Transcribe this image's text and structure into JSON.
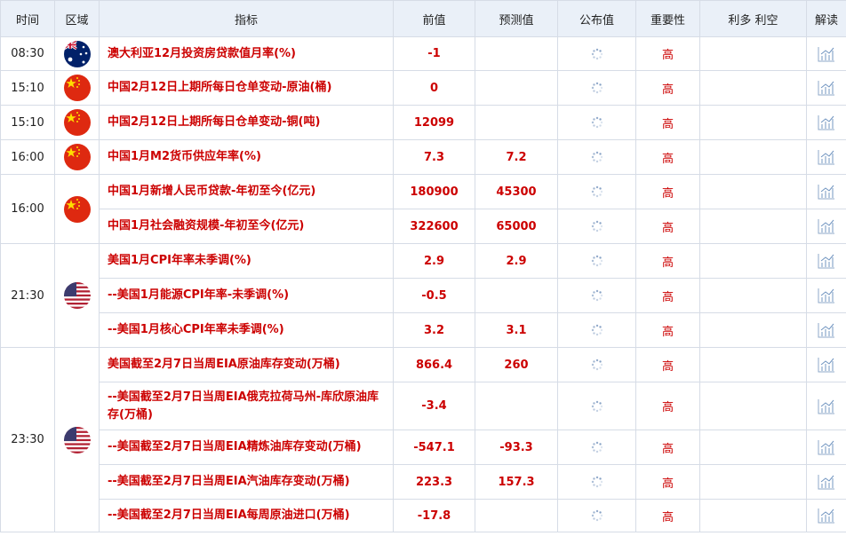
{
  "headers": {
    "time": "时间",
    "region": "区域",
    "indicator": "指标",
    "previous": "前值",
    "forecast": "预测值",
    "actual": "公布值",
    "importance": "重要性",
    "impact": "利多 利空",
    "analysis": "解读"
  },
  "colors": {
    "header_bg": "#eaf0f8",
    "accent_red": "#cc0000",
    "border": "#d6dce6"
  },
  "groups": [
    {
      "time": "08:30",
      "flag": "australia-flag-icon",
      "rows": [
        {
          "indicator": "澳大利亚12月投资房贷款值月率(%)",
          "previous": "-1",
          "forecast": "",
          "importance": "高"
        }
      ]
    },
    {
      "time": "15:10",
      "flag": "china-flag-icon",
      "rows": [
        {
          "indicator": "中国2月12日上期所每日仓单变动-原油(桶)",
          "previous": "0",
          "forecast": "",
          "importance": "高"
        }
      ]
    },
    {
      "time": "15:10",
      "flag": "china-flag-icon",
      "rows": [
        {
          "indicator": "中国2月12日上期所每日仓单变动-铜(吨)",
          "previous": "12099",
          "forecast": "",
          "importance": "高"
        }
      ]
    },
    {
      "time": "16:00",
      "flag": "china-flag-icon",
      "rows": [
        {
          "indicator": "中国1月M2货币供应年率(%)",
          "previous": "7.3",
          "forecast": "7.2",
          "importance": "高"
        }
      ]
    },
    {
      "time": "16:00",
      "flag": "china-flag-icon",
      "rows": [
        {
          "indicator": "中国1月新增人民币贷款-年初至今(亿元)",
          "previous": "180900",
          "forecast": "45300",
          "importance": "高"
        },
        {
          "indicator": "中国1月社会融资规模-年初至今(亿元)",
          "previous": "322600",
          "forecast": "65000",
          "importance": "高"
        }
      ]
    },
    {
      "time": "21:30",
      "flag": "usa-flag-icon",
      "rows": [
        {
          "indicator": "美国1月CPI年率未季调(%)",
          "previous": "2.9",
          "forecast": "2.9",
          "importance": "高"
        },
        {
          "indicator": "--美国1月能源CPI年率-未季调(%)",
          "previous": "-0.5",
          "forecast": "",
          "importance": "高"
        },
        {
          "indicator": "--美国1月核心CPI年率未季调(%)",
          "previous": "3.2",
          "forecast": "3.1",
          "importance": "高"
        }
      ]
    },
    {
      "time": "23:30",
      "flag": "usa-flag-icon",
      "rows": [
        {
          "indicator": "美国截至2月7日当周EIA原油库存变动(万桶)",
          "previous": "866.4",
          "forecast": "260",
          "importance": "高"
        },
        {
          "indicator": "--美国截至2月7日当周EIA俄克拉荷马州-库欣原油库存(万桶)",
          "previous": "-3.4",
          "forecast": "",
          "importance": "高"
        },
        {
          "indicator": "--美国截至2月7日当周EIA精炼油库存变动(万桶)",
          "previous": "-547.1",
          "forecast": "-93.3",
          "importance": "高"
        },
        {
          "indicator": "--美国截至2月7日当周EIA汽油库存变动(万桶)",
          "previous": "223.3",
          "forecast": "157.3",
          "importance": "高"
        },
        {
          "indicator": "--美国截至2月7日当周EIA每周原油进口(万桶)",
          "previous": "-17.8",
          "forecast": "",
          "importance": "高"
        }
      ]
    }
  ]
}
